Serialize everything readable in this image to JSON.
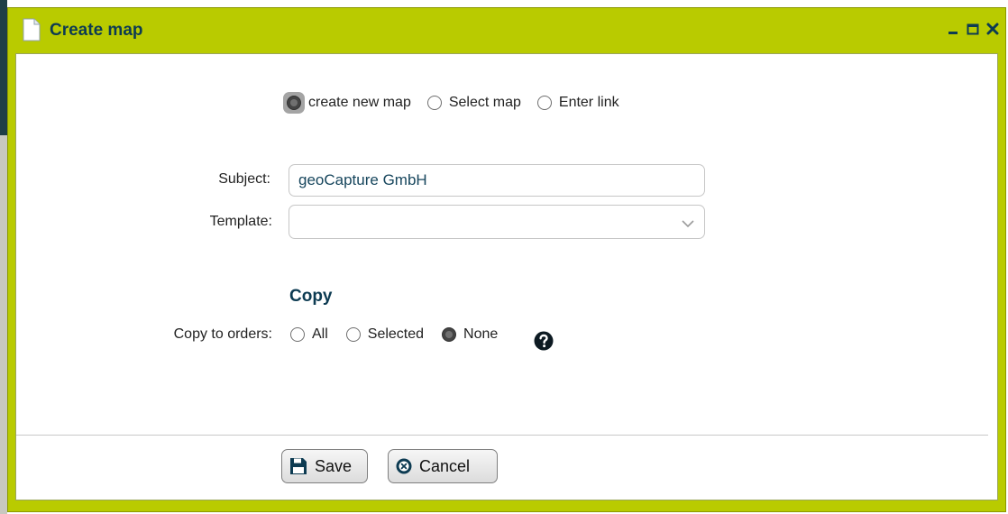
{
  "window": {
    "title": "Create map",
    "icons": {
      "document": "document-icon",
      "minimize": "minimize-icon",
      "maximize": "maximize-icon",
      "close": "close-icon"
    }
  },
  "mode_options": [
    {
      "label": "create new map",
      "selected": true
    },
    {
      "label": "Select map",
      "selected": false
    },
    {
      "label": "Enter link",
      "selected": false
    }
  ],
  "form": {
    "subject_label": "Subject:",
    "subject_value": "geoCapture GmbH",
    "template_label": "Template:",
    "template_value": ""
  },
  "copy_section": {
    "heading": "Copy",
    "label": "Copy to orders:",
    "options": [
      {
        "label": "All",
        "selected": false
      },
      {
        "label": "Selected",
        "selected": false
      },
      {
        "label": "None",
        "selected": true
      }
    ],
    "help_icon": "question-circle-icon"
  },
  "buttons": {
    "save_label": "Save",
    "cancel_label": "Cancel",
    "save_icon": "floppy-disk-icon",
    "cancel_icon": "cancel-circle-icon"
  },
  "colors": {
    "title_bar": "#b9cb00",
    "title_text": "#0d3b52",
    "heading": "#0d3b52",
    "input_text": "#17465d"
  }
}
